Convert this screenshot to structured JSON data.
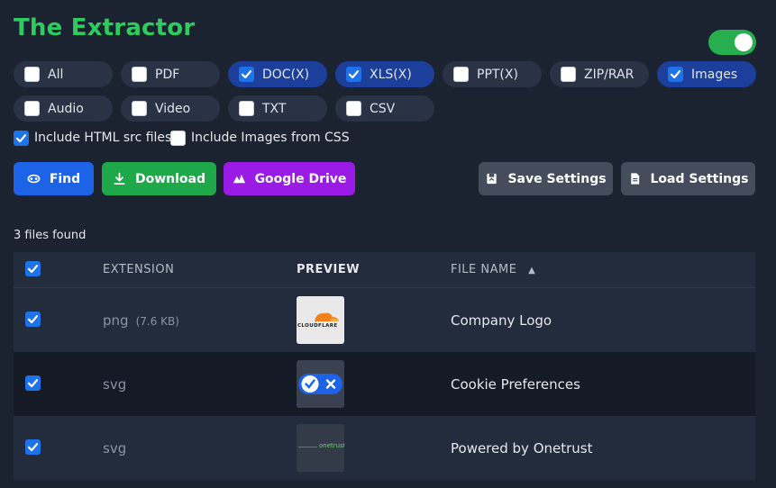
{
  "app": {
    "title": "The Extractor",
    "toggle_on": true
  },
  "filters": [
    {
      "label": "All",
      "checked": false
    },
    {
      "label": "PDF",
      "checked": false
    },
    {
      "label": "DOC(X)",
      "checked": true
    },
    {
      "label": "XLS(X)",
      "checked": true
    },
    {
      "label": "PPT(X)",
      "checked": false
    },
    {
      "label": "ZIP/RAR",
      "checked": false
    },
    {
      "label": "Images",
      "checked": true
    },
    {
      "label": "Audio",
      "checked": false
    },
    {
      "label": "Video",
      "checked": false
    },
    {
      "label": "TXT",
      "checked": false
    },
    {
      "label": "CSV",
      "checked": false
    }
  ],
  "options": {
    "html_src": {
      "label": "Include HTML src files",
      "checked": true
    },
    "css_images": {
      "label": "Include Images from CSS",
      "checked": false
    }
  },
  "buttons": {
    "find": "Find",
    "download": "Download",
    "drive": "Google Drive",
    "save": "Save Settings",
    "load": "Load Settings"
  },
  "colors": {
    "find": "#1d63e8",
    "download": "#1ea84a",
    "drive": "#9b1be6",
    "settings": "#454d5c",
    "title": "#2ecc5e"
  },
  "results": {
    "count_text": "3 files found"
  },
  "table": {
    "headers": {
      "extension": "EXTENSION",
      "preview": "PREVIEW",
      "file_name": "FILE NAME",
      "sort_indicator": "▲"
    },
    "rows": [
      {
        "checked": true,
        "ext": "png",
        "size": "(7.6 KB)",
        "name": "Company Logo",
        "preview": "cloudflare-logo",
        "preview_text": "CLOUDFLARE"
      },
      {
        "checked": true,
        "ext": "svg",
        "size": "",
        "name": "Cookie Preferences",
        "preview": "cookie-toggle-icon",
        "preview_text": ""
      },
      {
        "checked": true,
        "ext": "svg",
        "size": "",
        "name": "Powered by Onetrust",
        "preview": "onetrust-logo",
        "preview_text": "onetrust"
      }
    ]
  }
}
